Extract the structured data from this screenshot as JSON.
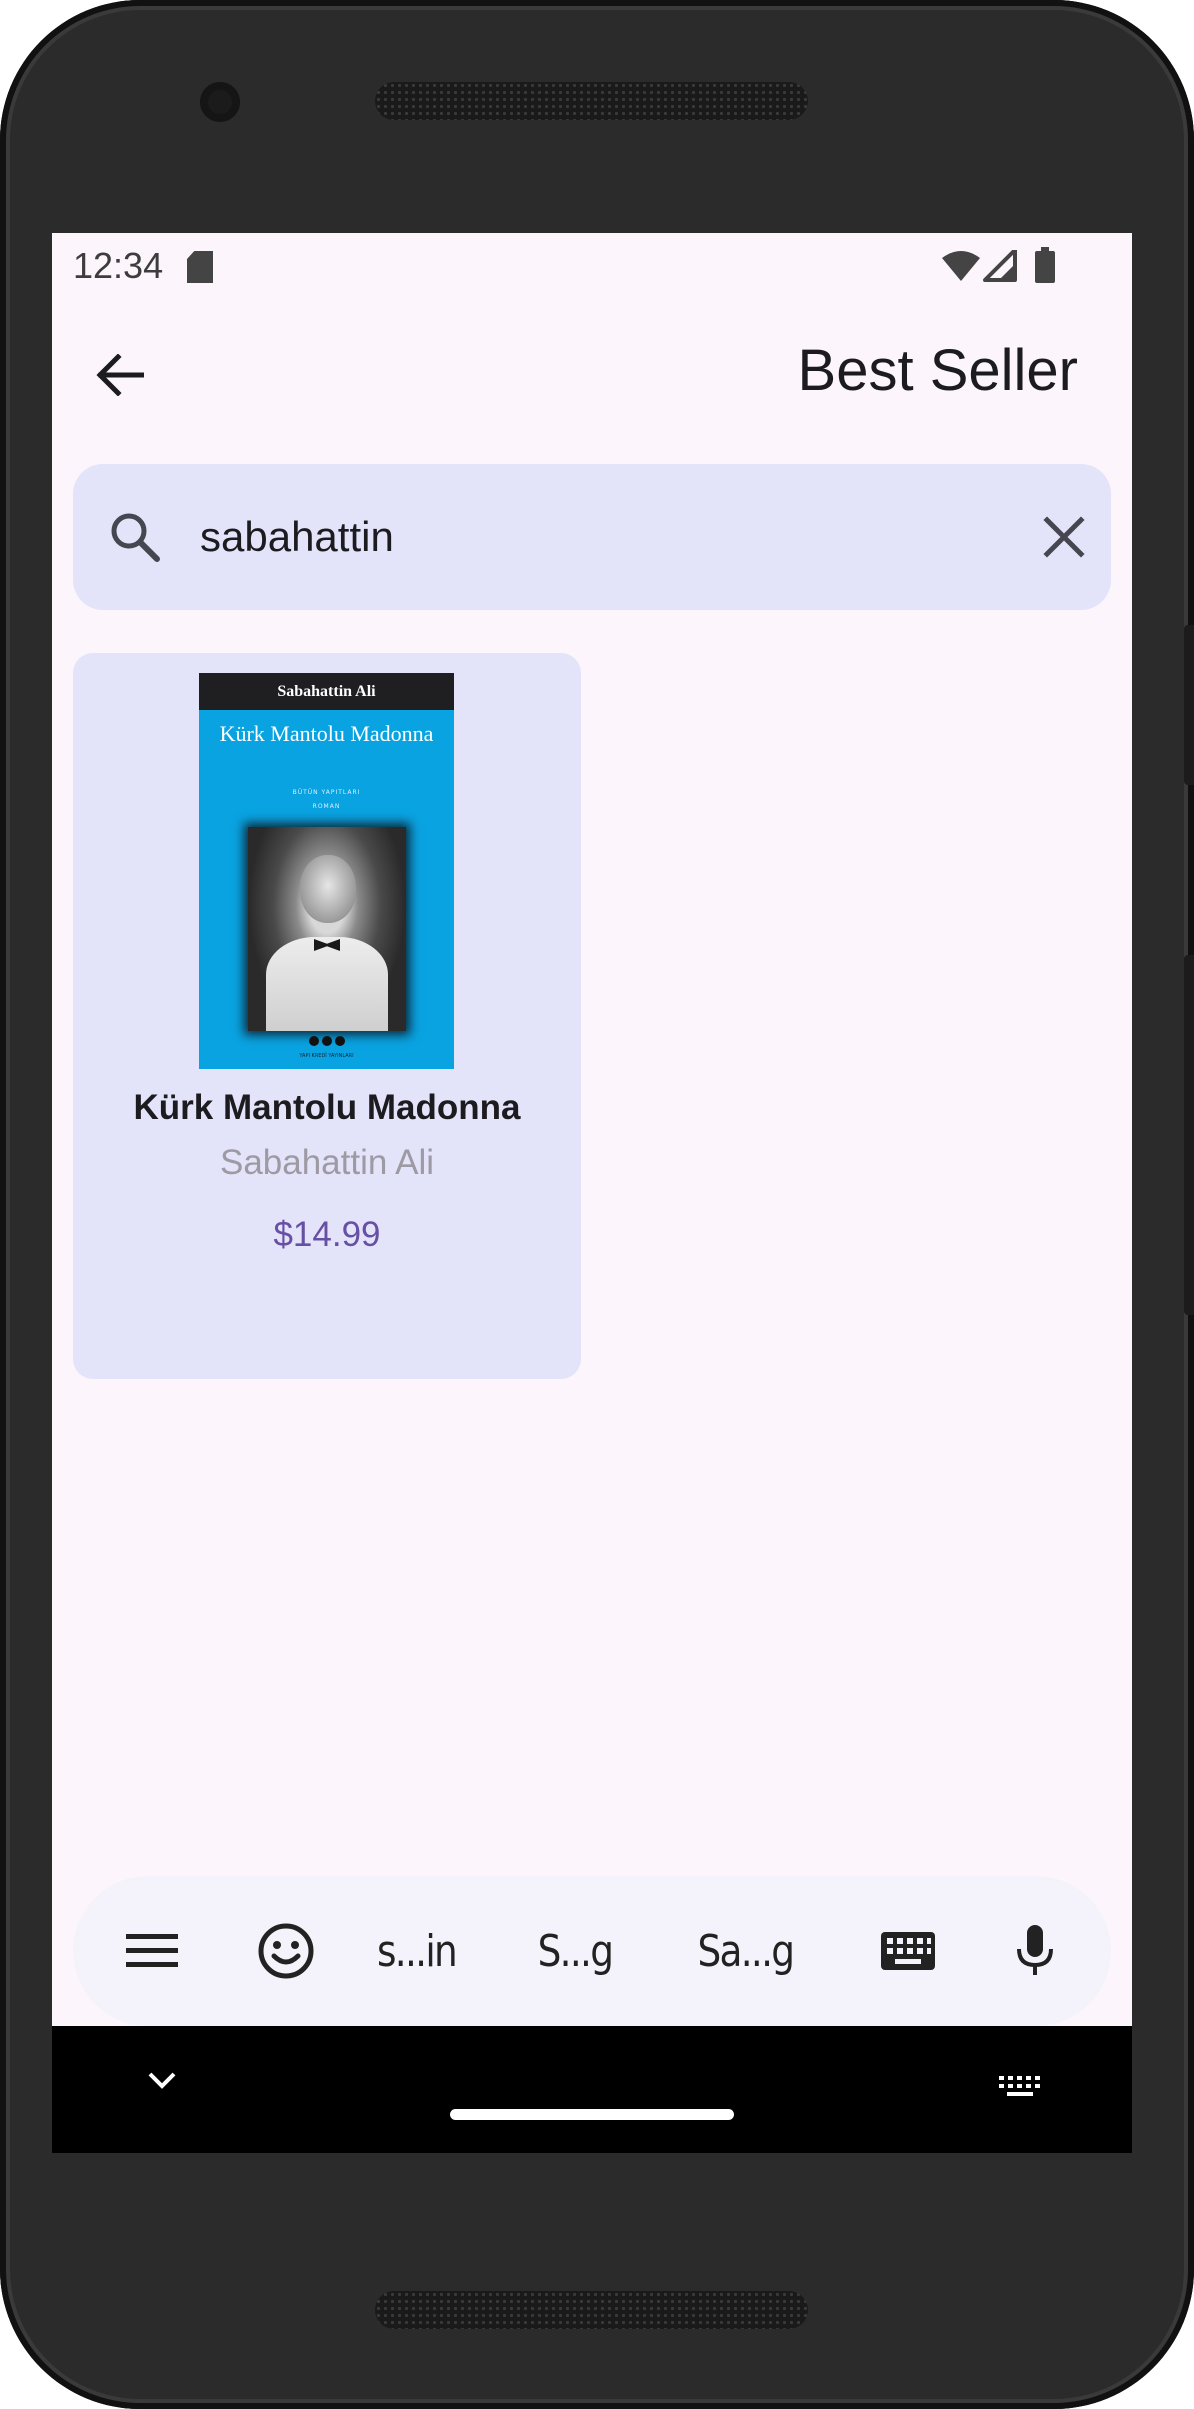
{
  "status_bar": {
    "time": "12:34",
    "icons": [
      "sd-card-icon",
      "wifi-icon",
      "signal-icon",
      "battery-icon"
    ]
  },
  "app_bar": {
    "back_icon": "arrow-left-icon",
    "title": "Best Seller"
  },
  "search": {
    "icon": "search-icon",
    "value": "sabahattin",
    "clear_icon": "close-icon"
  },
  "results": [
    {
      "title": "Kürk Mantolu Madonna",
      "author": "Sabahattin Ali",
      "price": "$14.99",
      "cover": {
        "author_band": "Sabahattin Ali",
        "title": "Kürk Mantolu Madonna",
        "series": "BÜTÜN YAPITLARI",
        "genre": "ROMAN",
        "publisher": "YAPI KREDİ YAYINLARI",
        "background_color": "#0aa3e2"
      }
    }
  ],
  "keyboard_strip": {
    "menu_icon": "menu-icon",
    "emoji_icon": "emoji-icon",
    "suggestions": [
      "s...in",
      "S...g",
      "Sa...g"
    ],
    "keyboard_icon": "keyboard-icon",
    "mic_icon": "microphone-icon"
  },
  "nav_bar": {
    "collapse_icon": "chevron-down-icon",
    "keyboard_switch_icon": "keyboard-switch-icon"
  },
  "colors": {
    "screen_background": "#fcf5fb",
    "surface": "#e3e3fa",
    "price_accent": "#6750a4",
    "author_text": "#9e9aa3"
  }
}
